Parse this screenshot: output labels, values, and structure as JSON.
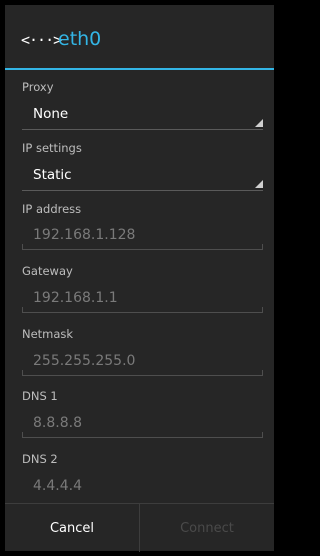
{
  "header": {
    "icon": "ethernet-icon",
    "icon_glyph": "<···>",
    "title": "eth0",
    "accent_color": "#33b5e5"
  },
  "proxy": {
    "label": "Proxy",
    "value": "None"
  },
  "ip_settings": {
    "label": "IP settings",
    "value": "Static"
  },
  "ip_address": {
    "label": "IP address",
    "value": "192.168.1.128"
  },
  "gateway": {
    "label": "Gateway",
    "value": "192.168.1.1"
  },
  "netmask": {
    "label": "Netmask",
    "value": "255.255.255.0"
  },
  "dns1": {
    "label": "DNS 1",
    "value": "8.8.8.8"
  },
  "dns2": {
    "label": "DNS 2",
    "value": "4.4.4.4"
  },
  "buttons": {
    "cancel": "Cancel",
    "connect": "Connect"
  }
}
